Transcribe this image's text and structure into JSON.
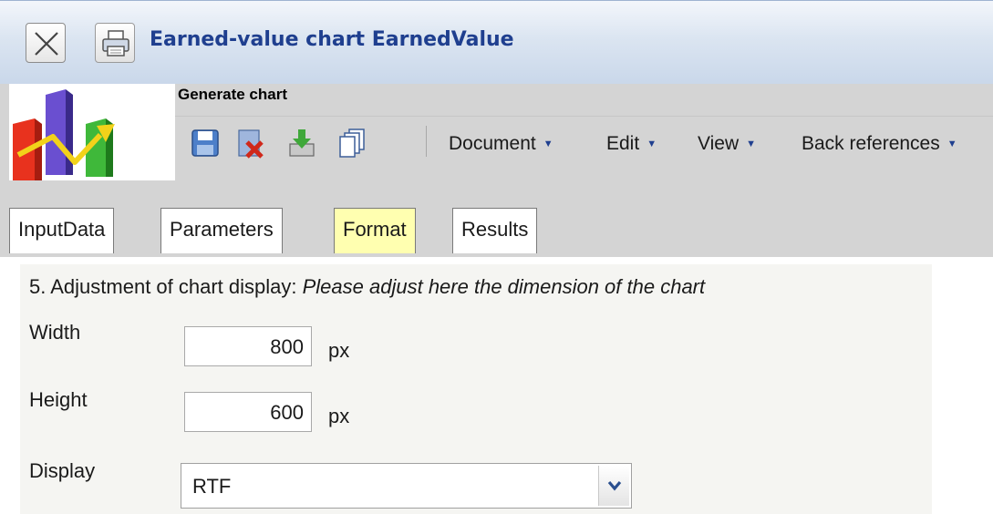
{
  "window": {
    "title": "Earned-value chart EarnedValue",
    "close_icon": "close-x-icon",
    "print_icon": "printer-icon"
  },
  "header": {
    "logo_icon": "bar-chart-trend-logo",
    "section_label": "Generate chart",
    "toolbar_icons": [
      "save-icon",
      "delete-document-icon",
      "download-icon",
      "copy-icon"
    ],
    "menus": [
      {
        "label": "Document"
      },
      {
        "label": "Edit"
      },
      {
        "label": "View"
      },
      {
        "label": "Back references"
      }
    ]
  },
  "tabs": [
    {
      "label": "InputData",
      "active": false
    },
    {
      "label": "Parameters",
      "active": false
    },
    {
      "label": "Format",
      "active": true
    },
    {
      "label": "Results",
      "active": false
    }
  ],
  "form": {
    "heading_prefix": "5. Adjustment of chart display:",
    "heading_hint": "Please adjust here the dimension of the chart",
    "width": {
      "label": "Width",
      "value": "800",
      "unit": "px"
    },
    "height": {
      "label": "Height",
      "value": "600",
      "unit": "px"
    },
    "display": {
      "label": "Display",
      "value": "RTF"
    }
  },
  "colors": {
    "title_text": "#1f3f8f",
    "active_tab": "#ffffb0",
    "menu_arrow": "#1f3f8f"
  }
}
